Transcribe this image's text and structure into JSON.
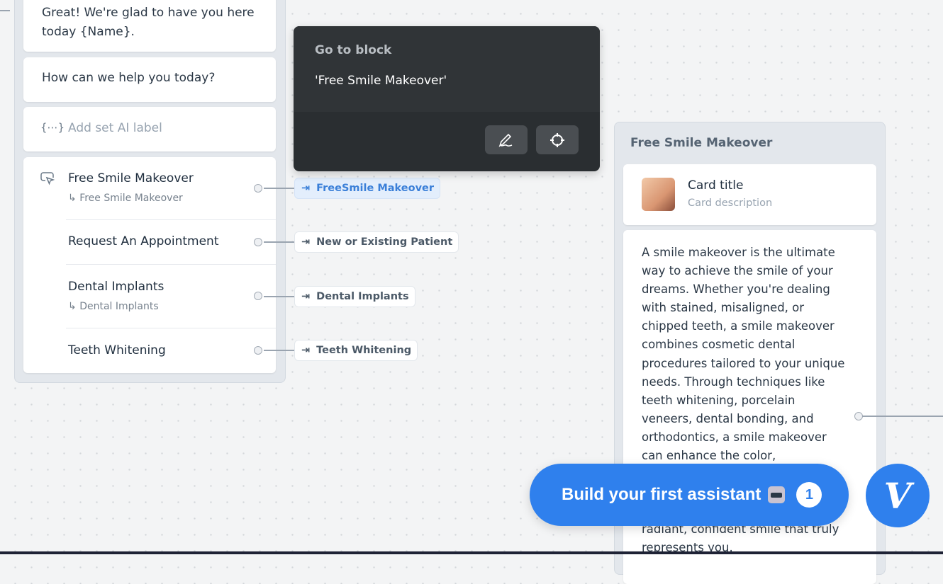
{
  "left_block": {
    "messages": [
      "Great! We're glad to have you here today {Name}.",
      "How can we help you today?"
    ],
    "ai_label_placeholder": "Add set AI label",
    "choices": [
      {
        "label": "Free Smile Makeover",
        "sub": "Free Smile Makeover",
        "target": "FreeSmile Makeover"
      },
      {
        "label": "Request An Appointment",
        "target": "New or Existing Patient"
      },
      {
        "label": "Dental Implants",
        "sub": "Dental Implants",
        "target": "Dental Implants"
      },
      {
        "label": "Teeth Whitening",
        "target": "Teeth Whitening"
      }
    ]
  },
  "tooltip": {
    "title": "Go to block",
    "value": "'Free Smile Makeover'"
  },
  "right_block": {
    "title": "Free Smile Makeover",
    "card_title": "Card title",
    "card_description": "Card description",
    "text": "A smile makeover is the ultimate way to achieve the smile of your dreams. Whether you're dealing with stained, misaligned, or chipped teeth, a smile makeover combines cosmetic dental procedures tailored to your unique needs. Through techniques like teeth whitening, porcelain veneers, dental bonding, and orthodontics, a smile makeover can enhance the color,",
    "text_tail": "radiant, confident smile that truly represents you."
  },
  "cta": {
    "label": "Build your first assistant",
    "badge": "1",
    "logo": "V"
  },
  "colors": {
    "accent": "#2f80ed",
    "tooltip_bg": "#2e3235"
  }
}
